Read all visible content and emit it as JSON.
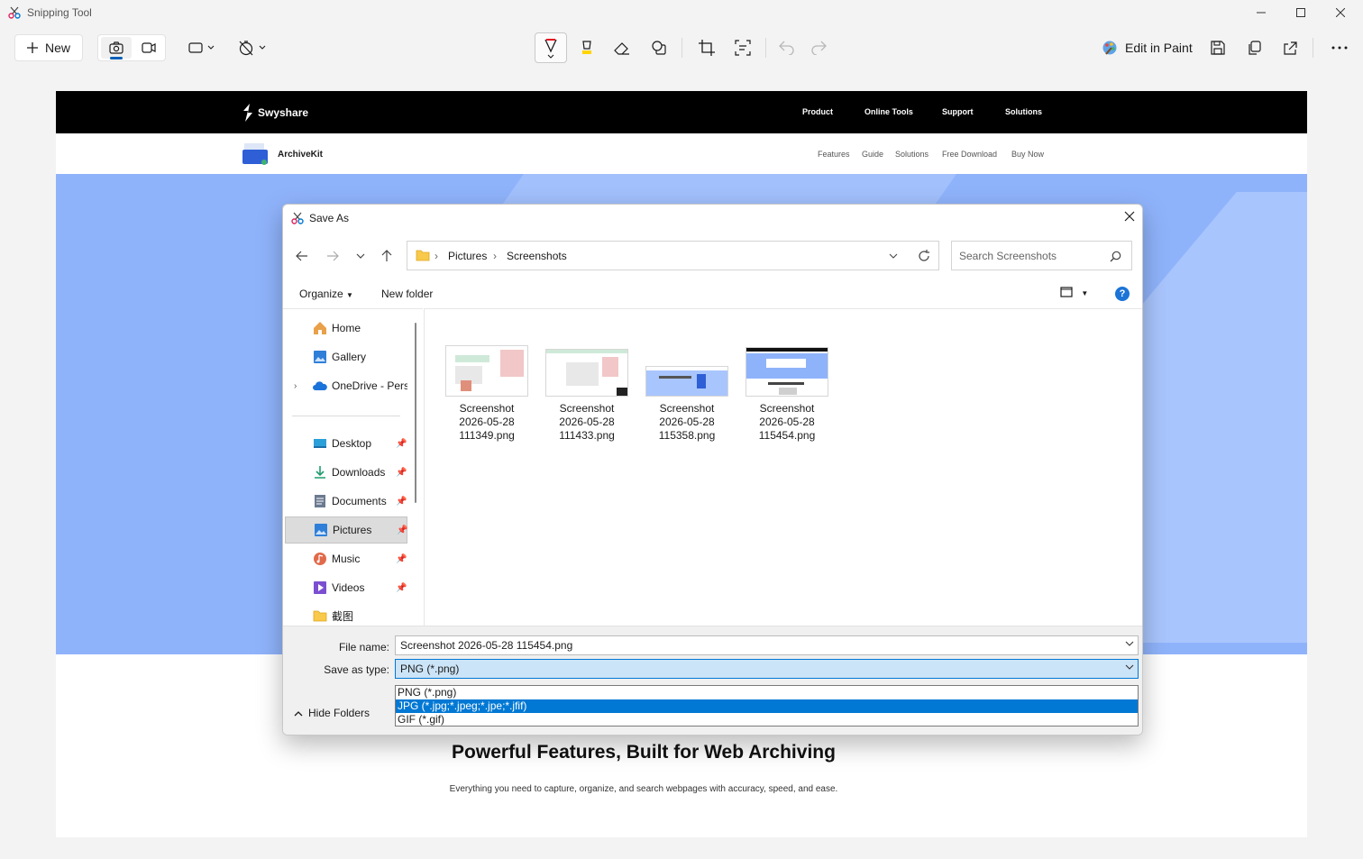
{
  "app": {
    "title": "Snipping Tool",
    "new_label": "New",
    "edit_in_paint": "Edit in Paint",
    "accent": "#005fb8"
  },
  "webpage": {
    "brand": "Swyshare",
    "menu": [
      "Product",
      "Online Tools",
      "Support",
      "Solutions"
    ],
    "product": "ArchiveKit",
    "submenu": [
      "Features",
      "Guide",
      "Solutions",
      "Free Download",
      "Buy Now"
    ],
    "features_title": "Powerful Features, Built for Web Archiving",
    "features_sub": "Everything you need to capture, organize, and search webpages with accuracy, speed, and ease.",
    "hero_color": "#8fb3fb"
  },
  "dialog": {
    "title": "Save As",
    "breadcrumb": [
      "Pictures",
      "Screenshots"
    ],
    "search_placeholder": "Search Screenshots",
    "organize": "Organize",
    "new_folder": "New folder",
    "help": "?",
    "sidebar": [
      {
        "label": "Home",
        "icon": "home-icon",
        "pinned": false
      },
      {
        "label": "Gallery",
        "icon": "gallery-icon",
        "pinned": false
      },
      {
        "label": "OneDrive - Personal",
        "icon": "onedrive-icon",
        "pinned": false
      },
      {
        "label": "Desktop",
        "icon": "desktop-icon",
        "pinned": true
      },
      {
        "label": "Downloads",
        "icon": "downloads-icon",
        "pinned": true
      },
      {
        "label": "Documents",
        "icon": "documents-icon",
        "pinned": true
      },
      {
        "label": "Pictures",
        "icon": "pictures-icon",
        "pinned": true,
        "selected": true
      },
      {
        "label": "Music",
        "icon": "music-icon",
        "pinned": true
      },
      {
        "label": "Videos",
        "icon": "videos-icon",
        "pinned": true
      },
      {
        "label": "截图",
        "icon": "folder-icon",
        "pinned": false
      }
    ],
    "files": [
      {
        "line1": "Screenshot",
        "line2": "2026-05-28",
        "line3": "111349.png"
      },
      {
        "line1": "Screenshot",
        "line2": "2026-05-28",
        "line3": "111433.png"
      },
      {
        "line1": "Screenshot",
        "line2": "2026-05-28",
        "line3": "115358.png"
      },
      {
        "line1": "Screenshot",
        "line2": "2026-05-28",
        "line3": "115454.png"
      }
    ],
    "file_name_label": "File name:",
    "file_name_value": "Screenshot 2026-05-28 115454.png",
    "save_type_label": "Save as type:",
    "save_type_value": "PNG (*.png)",
    "type_options": [
      "PNG (*.png)",
      "JPG (*.jpg;*.jpeg;*.jpe;*.jfif)",
      "GIF (*.gif)"
    ],
    "hide_folders": "Hide Folders"
  }
}
